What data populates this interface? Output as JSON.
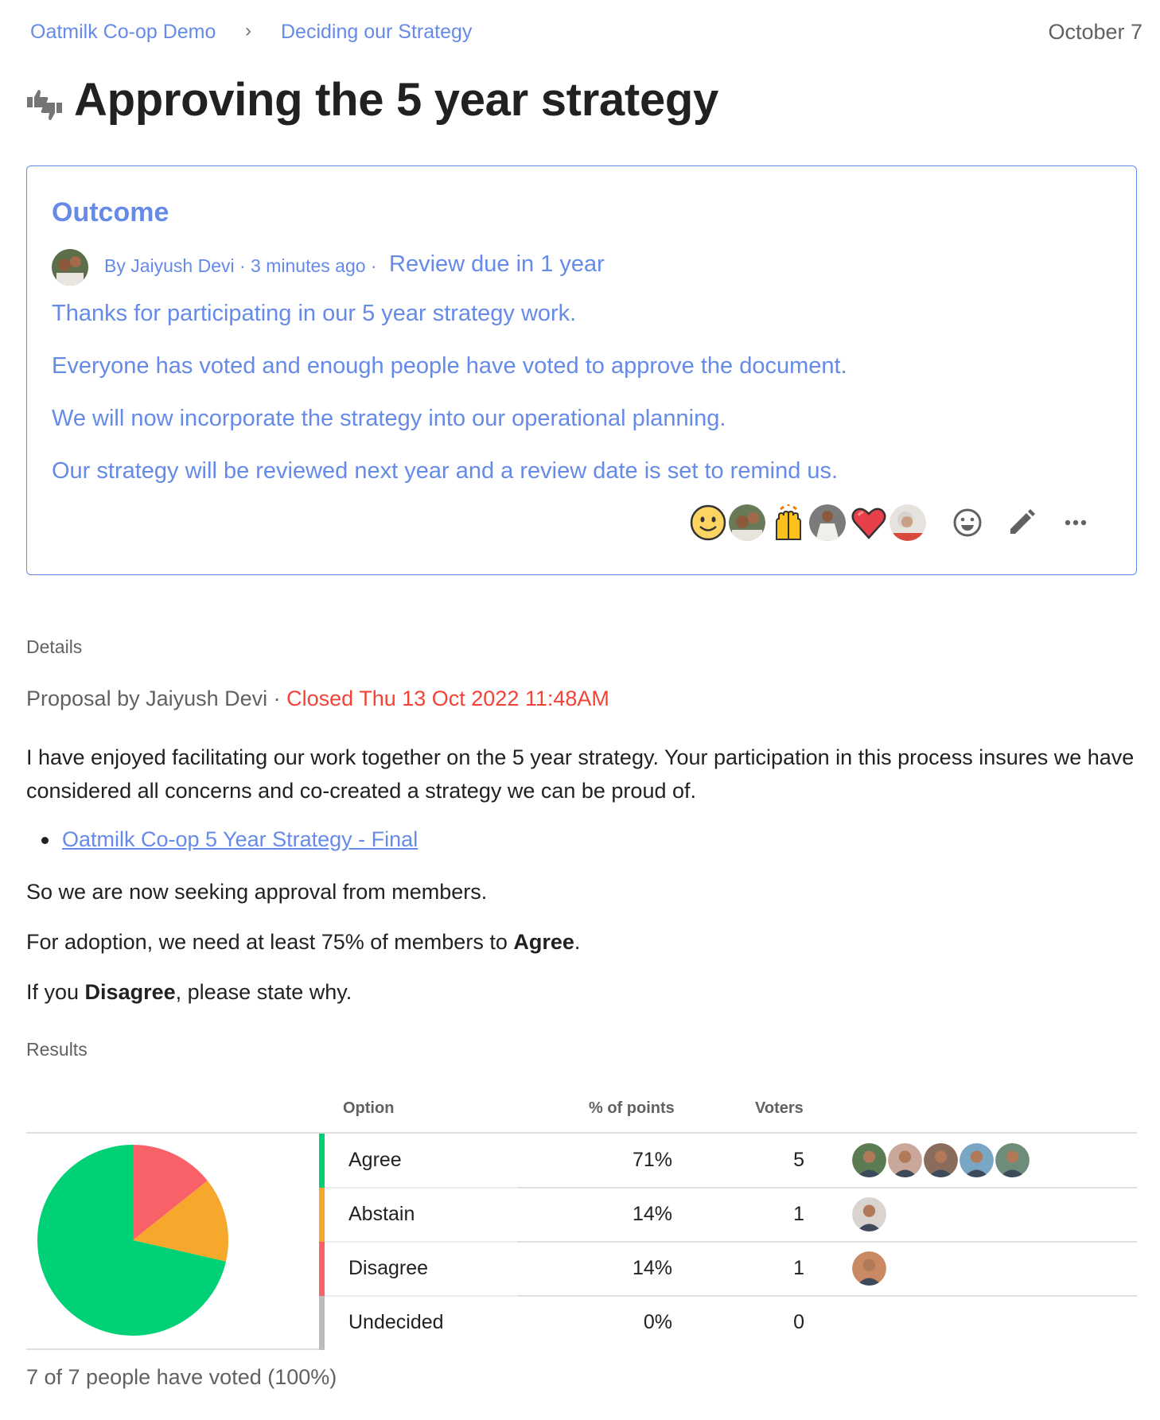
{
  "breadcrumb": {
    "group": "Oatmilk Co-op Demo",
    "separator": "›",
    "thread": "Deciding our Strategy"
  },
  "header": {
    "date": "October 7",
    "icon": "thumbs-up-down-icon",
    "title": "Approving the 5 year strategy"
  },
  "outcome": {
    "heading": "Outcome",
    "author_avatar": "avatar-jaiyush-devi",
    "byline": "By Jaiyush Devi · 3 minutes ago ·",
    "review": "Review due in 1 year",
    "lines": [
      "Thanks for participating in our 5 year strategy work.",
      "Everyone has voted and enough people have voted to approve the document.",
      "We will now incorporate the strategy into our operational planning.",
      "Our strategy will be reviewed next year and a review date is set to remind us."
    ],
    "reactions": [
      {
        "emoji": "slightly-smiling-face-icon",
        "user": "avatar-man-with-child"
      },
      {
        "emoji": "raising-hands-icon",
        "user": "avatar-woman-white-blazer"
      },
      {
        "emoji": "red-heart-icon",
        "user": "avatar-grey-haired-woman"
      }
    ],
    "actions": [
      "add-reaction-icon",
      "edit-pencil-icon",
      "more-options-icon"
    ]
  },
  "details": {
    "label": "Details",
    "proposal_by": "Proposal by Jaiyush Devi ·",
    "closed": "Closed Thu 13 Oct 2022 11:48AM",
    "para1": "I have enjoyed facilitating our work together on the 5 year strategy. Your participation in this process insures we have considered all concerns and co-created a strategy we can be proud of.",
    "link": "Oatmilk Co-op 5 Year Strategy - Final",
    "para2": "So we are now seeking approval from members.",
    "para3_pre": "For adoption, we need at least 75% of members to ",
    "para3_bold": "Agree",
    "para3_post": ".",
    "para4_pre": "If you ",
    "para4_bold": "Disagree",
    "para4_post": ", please state why."
  },
  "results": {
    "label": "Results",
    "columns": {
      "option": "Option",
      "pct": "% of points",
      "voters": "Voters"
    },
    "rows": [
      {
        "option": "Agree",
        "pct": "71%",
        "voters": "5",
        "color": "#00d177",
        "avatars": [
          "#5b7b52",
          "#c9a79a",
          "#8a6c5c",
          "#7aa6c6",
          "#6d8c7a"
        ]
      },
      {
        "option": "Abstain",
        "pct": "14%",
        "voters": "1",
        "color": "#f6a82c",
        "avatars": [
          "#d9d4cf"
        ]
      },
      {
        "option": "Disagree",
        "pct": "14%",
        "voters": "1",
        "color": "#f96168",
        "avatars": [
          "#c98a63"
        ]
      },
      {
        "option": "Undecided",
        "pct": "0%",
        "voters": "0",
        "color": "#bbbbbb",
        "avatars": []
      }
    ],
    "footer": "7 of 7 people have voted (100%)"
  },
  "chart_data": {
    "type": "pie",
    "title": "",
    "categories": [
      "Disagree",
      "Abstain",
      "Agree"
    ],
    "values": [
      1,
      1,
      5
    ],
    "colors": [
      "#f96168",
      "#f6a82c",
      "#00d177"
    ],
    "start": "12 o'clock, clockwise",
    "legend": "table-right"
  },
  "colors": {
    "accent": "#658ae7",
    "closed": "#f44336"
  }
}
